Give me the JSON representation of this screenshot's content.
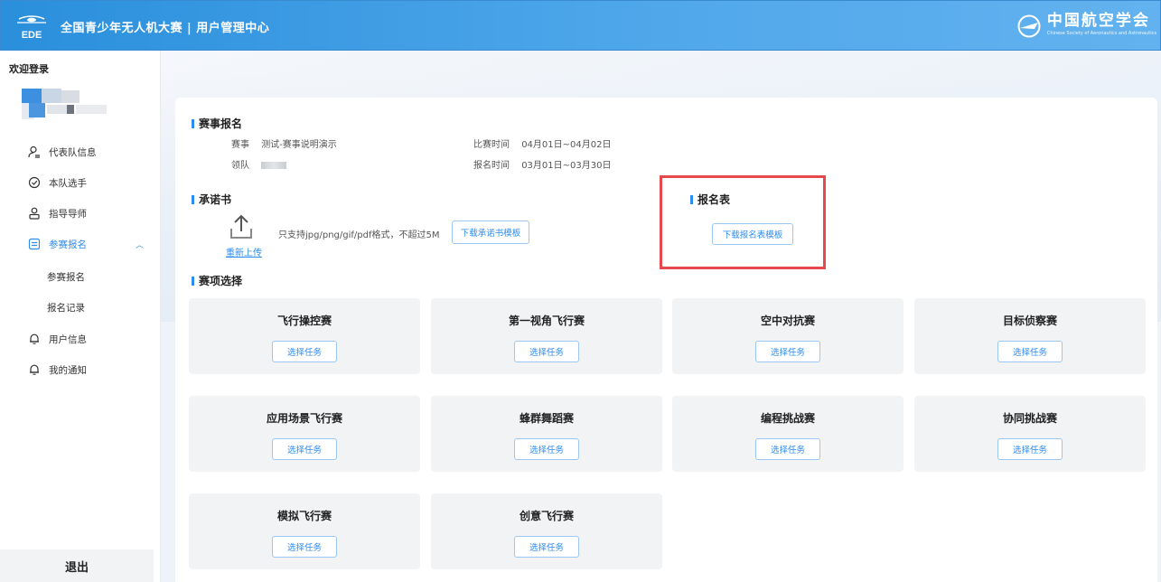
{
  "header": {
    "logo_text": "EDE",
    "app_title": "全国青少年无人机大赛 | 用户管理中心",
    "brand_cn": "中国航空学会",
    "brand_en": "Chinese Society of Aeronautics and Astronautics"
  },
  "sidebar": {
    "welcome": "欢迎登录",
    "menu": [
      {
        "label": "代表队信息",
        "icon": "user-icon"
      },
      {
        "label": "本队选手",
        "icon": "check-circle-icon"
      },
      {
        "label": "指导导师",
        "icon": "users-icon"
      },
      {
        "label": "参赛报名",
        "icon": "form-icon",
        "active": true,
        "expanded": true
      },
      {
        "label": "用户信息",
        "icon": "bell-icon"
      },
      {
        "label": "我的通知",
        "icon": "bell-icon"
      }
    ],
    "submenu": [
      "参赛报名",
      "报名记录"
    ],
    "logout": "退出"
  },
  "main": {
    "registration": {
      "title": "赛事报名",
      "event_label": "赛事",
      "event_value": "测试-赛事说明演示",
      "leader_label": "领队",
      "match_time_label": "比赛时间",
      "match_time_value": "04月01日~04月02日",
      "signup_time_label": "报名时间",
      "signup_time_value": "03月01日~03月30日"
    },
    "commitment": {
      "title": "承诺书",
      "reupload": "重新上传",
      "hint": "只支持jpg/png/gif/pdf格式，不超过5M",
      "download_button": "下载承诺书模板"
    },
    "signup_form": {
      "title": "报名表",
      "download_button": "下载报名表模板"
    },
    "events": {
      "title": "赛项选择",
      "select_label": "选择任务",
      "items": [
        "飞行操控赛",
        "第一视角飞行赛",
        "空中对抗赛",
        "目标侦察赛",
        "应用场景飞行赛",
        "蜂群舞蹈赛",
        "编程挑战赛",
        "协同挑战赛",
        "模拟飞行赛",
        "创意飞行赛"
      ]
    }
  },
  "colors": {
    "header_blue": "#3d9be6",
    "accent": "#2d8cf0",
    "highlight": "#e5484d"
  }
}
